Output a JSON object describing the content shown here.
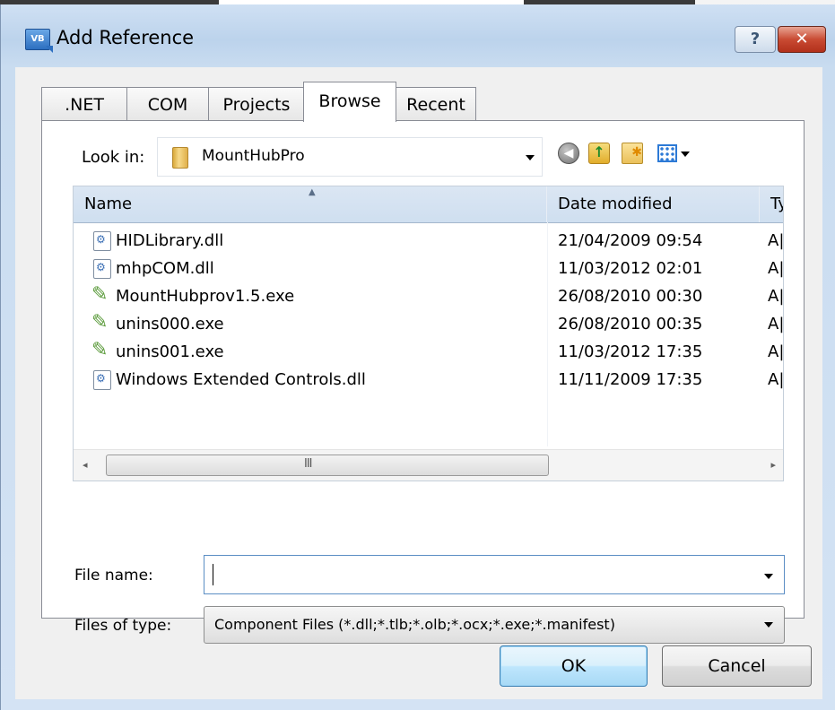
{
  "window": {
    "title": "Add Reference",
    "icon_label": "VB",
    "help_label": "?",
    "close_label": "✕"
  },
  "tabs": [
    {
      "label": ".NET",
      "active": false
    },
    {
      "label": "COM",
      "active": false
    },
    {
      "label": "Projects",
      "active": false
    },
    {
      "label": "Browse",
      "active": true
    },
    {
      "label": "Recent",
      "active": false
    }
  ],
  "lookin": {
    "label": "Look in:",
    "value": "MountHubPro"
  },
  "columns": {
    "name": "Name",
    "date": "Date modified",
    "type": "Ty"
  },
  "files": [
    {
      "name": "HIDLibrary.dll",
      "date": "21/04/2009 09:54",
      "type": "A|",
      "icon": "dll-file-icon"
    },
    {
      "name": "mhpCOM.dll",
      "date": "11/03/2012 02:01",
      "type": "A|",
      "icon": "dll-file-icon"
    },
    {
      "name": "MountHubprov1.5.exe",
      "date": "26/08/2010 00:30",
      "type": "A|",
      "icon": "exe-file-icon"
    },
    {
      "name": "unins000.exe",
      "date": "26/08/2010 00:35",
      "type": "A|",
      "icon": "exe-file-icon"
    },
    {
      "name": "unins001.exe",
      "date": "11/03/2012 17:35",
      "type": "A|",
      "icon": "exe-file-icon"
    },
    {
      "name": "Windows Extended Controls.dll",
      "date": "11/11/2009 17:35",
      "type": "A|",
      "icon": "dll-file-icon"
    }
  ],
  "scrollbar": {
    "left_arrow": "◂",
    "right_arrow": "▸",
    "grip": "III"
  },
  "filename": {
    "label": "File name:",
    "value": ""
  },
  "filetype": {
    "label": "Files of type:",
    "value": "Component Files (*.dll;*.tlb;*.olb;*.ocx;*.exe;*.manifest)"
  },
  "buttons": {
    "ok": "OK",
    "cancel": "Cancel"
  }
}
